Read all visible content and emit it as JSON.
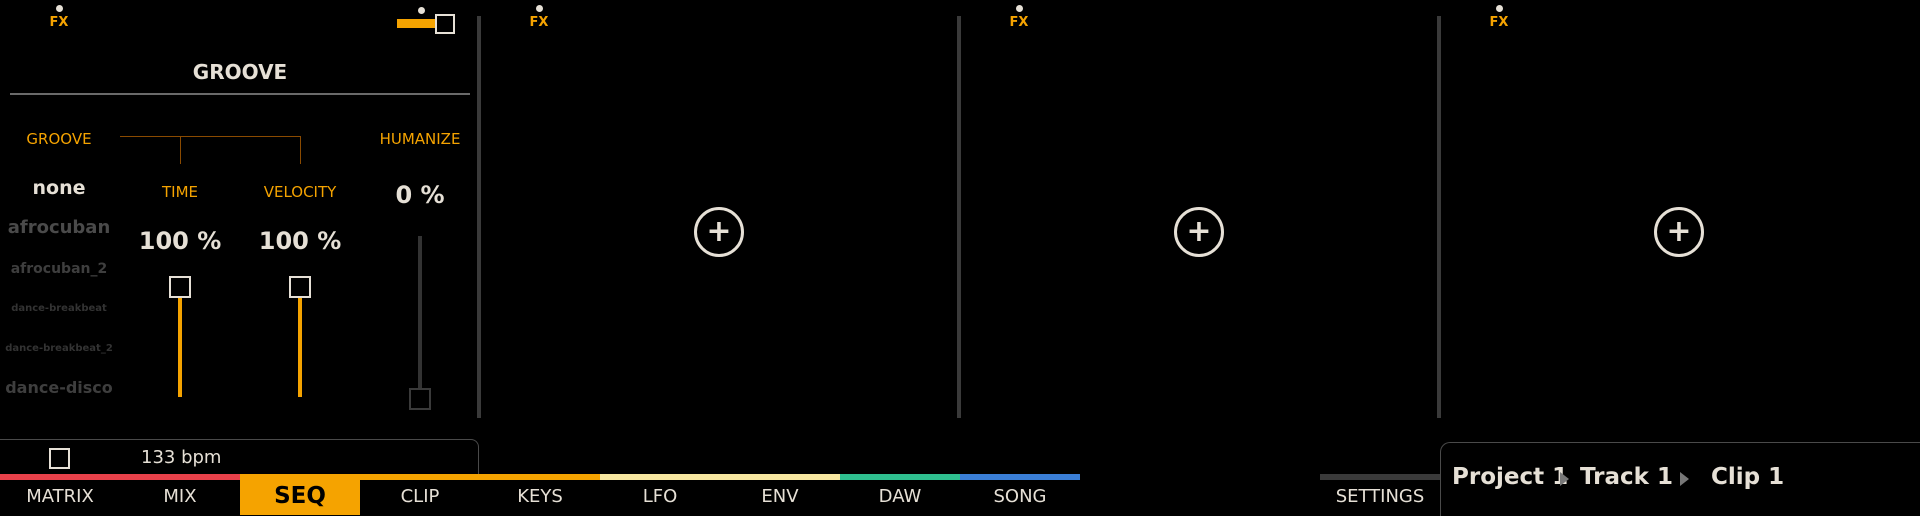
{
  "fx_label": "FX",
  "groove": {
    "title": "GROOVE",
    "col_groove": "GROOVE",
    "col_time": "TIME",
    "col_velocity": "VELOCITY",
    "col_humanize": "HUMANIZE",
    "items": [
      "none",
      "afrocuban",
      "afrocuban_2",
      "dance-breakbeat",
      "dance-breakbeat_2",
      "dance-disco"
    ],
    "time_value": "100 %",
    "velocity_value": "100 %",
    "humanize_value": "0 %",
    "time_level": 1.0,
    "velocity_level": 1.0,
    "humanize_level": 0.0
  },
  "status": {
    "bpm": "133 bpm"
  },
  "tabs": [
    "MATRIX",
    "MIX",
    "SEQ",
    "CLIP",
    "KEYS",
    "LFO",
    "ENV",
    "DAW",
    "SONG"
  ],
  "active_tab": "SEQ",
  "settings_label": "SETTINGS",
  "breadcrumb": {
    "project": "Project 1",
    "track": "Track 1",
    "clip": "Clip 1"
  },
  "colors": {
    "accent": "#f5a300",
    "bar_red": "#e8414a",
    "bar_orange": "#f5a300",
    "bar_yellow": "#f7e7a0",
    "bar_green": "#2fbf8f",
    "bar_blue": "#3a7ed6"
  }
}
